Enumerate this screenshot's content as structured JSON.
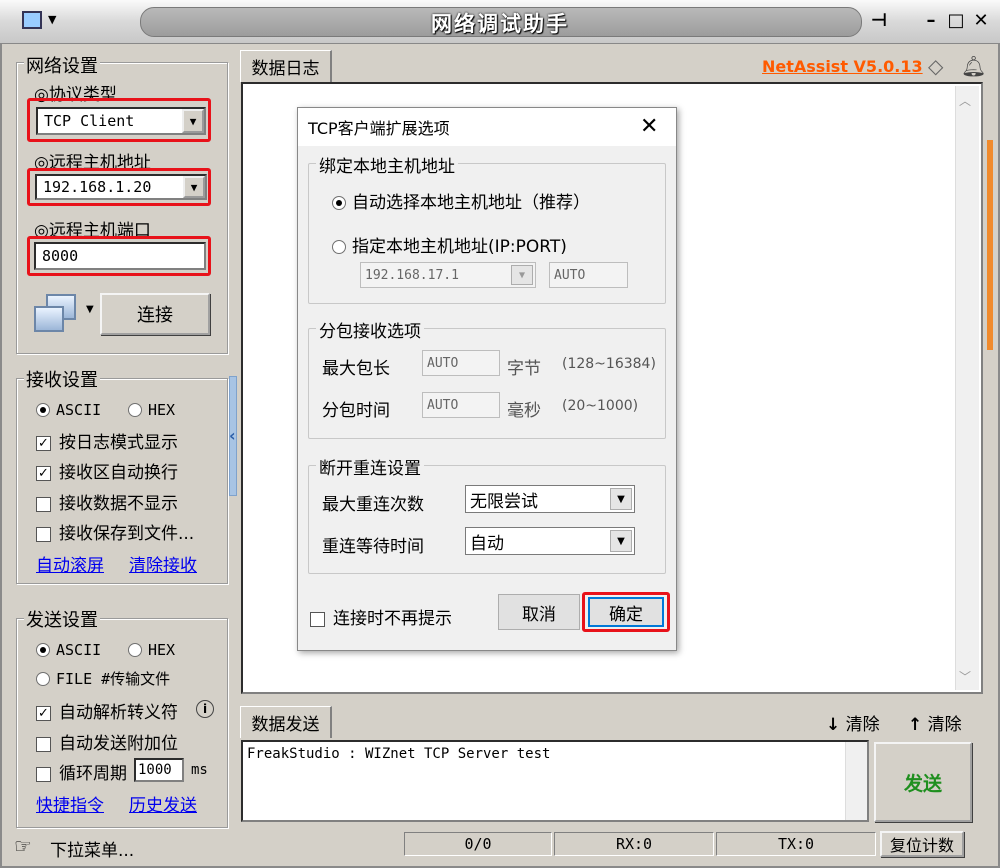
{
  "window": {
    "title": "网络调试助手"
  },
  "network": {
    "group_label": "网络设置",
    "protocol_label": "◎协议类型",
    "protocol_value": "TCP Client",
    "host_label": "◎远程主机地址",
    "host_value": "192.168.1.20",
    "port_label": "◎远程主机端口",
    "port_value": "8000",
    "connect_label": "连接"
  },
  "receive": {
    "group_label": "接收设置",
    "ascii": "ASCII",
    "hex": "HEX",
    "options": [
      "按日志模式显示",
      "接收区自动换行",
      "接收数据不显示",
      "接收保存到文件..."
    ],
    "checked": [
      true,
      true,
      false,
      false
    ],
    "link_autoscroll": "自动滚屏",
    "link_clear": "清除接收"
  },
  "send": {
    "group_label": "发送设置",
    "ascii": "ASCII",
    "hex": "HEX",
    "file": "FILE #传输文件",
    "options": [
      "自动解析转义符",
      "自动发送附加位",
      "循环周期"
    ],
    "checked": [
      true,
      false,
      false
    ],
    "period_value": "1000",
    "period_unit": "ms",
    "link_shortcut": "快捷指令",
    "link_history": "历史发送"
  },
  "log": {
    "tab_label": "数据日志",
    "brand": "NetAssist V5.0.13"
  },
  "send_area": {
    "tab_label": "数据发送",
    "clear1": "清除",
    "clear2": "清除",
    "content": "FreakStudio : WIZnet TCP Server test",
    "send_button": "发送"
  },
  "status": {
    "menu": "下拉菜单...",
    "counter": "0/0",
    "rx": "RX:0",
    "tx": "TX:0",
    "reset": "复位计数"
  },
  "dialog": {
    "title": "TCP客户端扩展选项",
    "bind_group": "绑定本地主机地址",
    "bind_auto": "自动选择本地主机地址（推荐）",
    "bind_manual": "指定本地主机地址(IP:PORT)",
    "bind_ip": "192.168.17.1",
    "bind_port": "AUTO",
    "packet_group": "分包接收选项",
    "max_len_label": "最大包长",
    "max_len_value": "AUTO",
    "max_len_unit": "字节",
    "max_len_range": "(128~16384)",
    "split_time_label": "分包时间",
    "split_time_value": "AUTO",
    "split_time_unit": "毫秒",
    "split_time_range": "(20~1000)",
    "reconnect_group": "断开重连设置",
    "max_retry_label": "最大重连次数",
    "max_retry_value": "无限尝试",
    "retry_wait_label": "重连等待时间",
    "retry_wait_value": "自动",
    "no_prompt": "连接时不再提示",
    "cancel": "取消",
    "ok": "确定"
  }
}
